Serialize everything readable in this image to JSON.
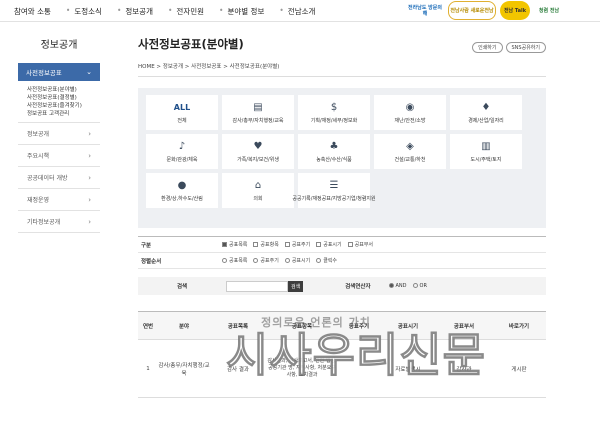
{
  "topnav": {
    "items": [
      "참여와 소통",
      "도정소식",
      "정보공개",
      "전자민원",
      "분야별 정보",
      "전남소개"
    ],
    "logos": [
      "전라남도 방문의해",
      "전남사람 새로운전남",
      "전남 Talk",
      "청렴 전남"
    ]
  },
  "sidebar": {
    "title": "정보공개",
    "active": "사전정보공표",
    "sub": [
      "사전정보공표(분야별)",
      "사전정보공표(결정별)",
      "사전정보공표(즐겨찾기)",
      "정보공표 고객관리"
    ],
    "items": [
      "정보공개",
      "주요시책",
      "공공데이터 개방",
      "재정운영",
      "기타정보공개"
    ]
  },
  "main": {
    "title": "사전정보공표(분야별)",
    "btn_print": "인쇄하기",
    "btn_sns": "SNS공유하기",
    "breadcrumb": "HOME > 정보공개 > 사전정보공표 > 사전정보공표(분야별)",
    "categories": [
      {
        "label": "전체",
        "icon": "ALL"
      },
      {
        "label": "감사/총무/자치행정/교육",
        "icon": "▤"
      },
      {
        "label": "기획/재정/세무/정보화",
        "icon": "$"
      },
      {
        "label": "재난/안전/소방",
        "icon": "◉"
      },
      {
        "label": "경제/산업/일자리",
        "icon": "♦"
      },
      {
        "label": "문화/관광/체육",
        "icon": "♪"
      },
      {
        "label": "가족/복지/보건/위생",
        "icon": "♥"
      },
      {
        "label": "농축산/수산/식품",
        "icon": "♣"
      },
      {
        "label": "건설/교통/하천",
        "icon": "◈"
      },
      {
        "label": "도시/주택/토지",
        "icon": "▥"
      },
      {
        "label": "환경/상,하수도/산림",
        "icon": "●"
      },
      {
        "label": "의회",
        "icon": "⌂"
      },
      {
        "label": "공공기록/재정공표/지방공기업/청렴지원",
        "icon": "☰"
      }
    ]
  },
  "filter": {
    "group_label": "구분",
    "group_opts": [
      "공표목록",
      "공표항목",
      "공표주기",
      "공표시기",
      "공표부서"
    ],
    "sort_label": "정렬순서",
    "sort_opts": [
      "공표목록",
      "공표주기",
      "공표시기",
      "클릭수"
    ]
  },
  "search": {
    "label": "검색",
    "btn": "검색",
    "op_label": "검색연산자",
    "op_and": "AND",
    "op_or": "OR"
  },
  "table": {
    "headers": [
      "연번",
      "분야",
      "공표목록",
      "공표항목",
      "공표주기",
      "공표시기",
      "공표부서",
      "바로가기"
    ],
    "row": {
      "no": "1",
      "field": "감사/총무/자치행정/교육",
      "list": "감사 결과",
      "item": "감사결과, 감사보고서, 관련 법령, 공공기관 명, 지적사항, 처분요구 사항, 조치결과",
      "cycle": "",
      "timing": "자료발생시",
      "dept": "감사관",
      "link": "게시판"
    }
  },
  "watermark": {
    "small": "정의로운 언론의 가치",
    "big": "시사우리신문"
  }
}
